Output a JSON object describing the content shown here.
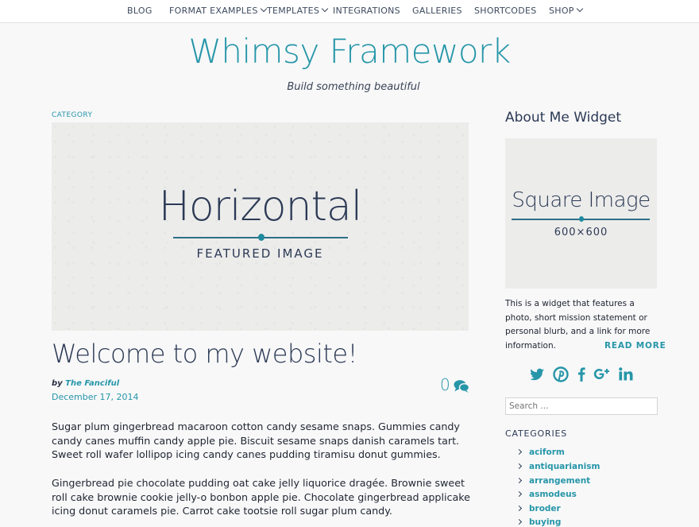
{
  "nav": {
    "items": [
      {
        "label": "BLOG",
        "dropdown": false
      },
      {
        "label": "FORMAT EXAMPLES",
        "dropdown": true
      },
      {
        "label": "TEMPLATES",
        "dropdown": true
      },
      {
        "label": "INTEGRATIONS",
        "dropdown": false
      },
      {
        "label": "GALLERIES",
        "dropdown": false
      },
      {
        "label": "SHORTCODES",
        "dropdown": false
      },
      {
        "label": "SHOP",
        "dropdown": true
      }
    ]
  },
  "header": {
    "title": "Whimsy Framework",
    "tagline": "Build something beautiful"
  },
  "post": {
    "category": "CATEGORY",
    "featured_image": {
      "main": "Horizontal",
      "sub": "FEATURED IMAGE"
    },
    "title": "Welcome to my website!",
    "by": "by ",
    "author": "The Fanciful",
    "date": "December 17, 2014",
    "comment_count": "0",
    "paragraphs": [
      "Sugar plum gingerbread macaroon cotton candy sesame snaps. Gummies candy candy canes muffin candy apple pie. Biscuit sesame snaps danish caramels tart. Sweet roll wafer lollipop icing candy canes pudding tiramisu donut gummies.",
      "Gingerbread pie chocolate pudding oat cake jelly liquorice dragée. Brownie sweet roll cake brownie cookie jelly-o bonbon apple pie. Chocolate gingerbread applicake icing donut caramels pie. Carrot cake tootsie roll sugar plum candy."
    ]
  },
  "sidebar": {
    "about": {
      "title": "About Me Widget",
      "image_main": "Square Image",
      "image_sub": "600×600",
      "text": "This is a widget that features a photo, short mission statement or personal blurb, and a link for more information.",
      "read_more": "READ MORE"
    },
    "social": [
      "twitter-icon",
      "pinterest-icon",
      "facebook-icon",
      "google-plus-icon",
      "linkedin-icon"
    ],
    "search_placeholder": "Search ...",
    "categories_title": "CATEGORIES",
    "categories": [
      "aciform",
      "antiquarianism",
      "arrangement",
      "asmodeus",
      "broder",
      "buying"
    ]
  },
  "colors": {
    "accent": "#2696a8",
    "text_dark": "#2c3a55",
    "background": "#f8f8f9"
  }
}
